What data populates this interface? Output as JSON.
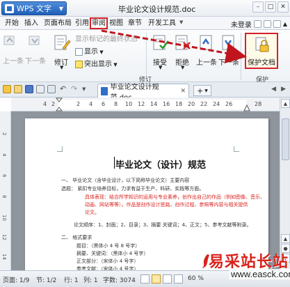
{
  "titlebar": {
    "app_button": "WPS 文字",
    "doc_title": "毕业论文设计规范.doc"
  },
  "menu": {
    "tabs": [
      "开始",
      "插入",
      "页面布局",
      "引用",
      "审阅",
      "视图",
      "章节",
      "开发工具"
    ],
    "active_tab": "审阅",
    "login": "未登录"
  },
  "ribbon": {
    "prev_label": "上一条",
    "next_label": "下一条",
    "revise_label": "修订",
    "show_markup_final": "显示标记的最终状态",
    "show_label": "显示",
    "highlight_label": "突出显示",
    "accept_label": "接受",
    "reject_label": "拒绝",
    "prev_change": "上一条",
    "next_change": "下一条",
    "group_revise": "修订",
    "protect_doc": "保护文档",
    "group_protect": "保护"
  },
  "doc_tab": {
    "title": "毕业论文设计规范.doc",
    "new_tab": "+"
  },
  "ruler": {
    "ticks": [
      "4",
      "2",
      "2",
      "4",
      "6",
      "8",
      "10",
      "12",
      "14",
      "16",
      "18",
      "20",
      "22",
      "24",
      "26",
      "28"
    ]
  },
  "vruler": {
    "ticks": [
      "2",
      "4",
      "6",
      "8",
      "10",
      "12",
      "14"
    ]
  },
  "document": {
    "heading": "毕业论文（设计）规范",
    "lines": [
      {
        "text": "一、  毕业论文（含毕业设计，以下简称毕业论文）主要内容",
        "red": false
      },
      {
        "text": "选题：  紧扣专业培养目标，力求有益于生产、科研、实践等方面。",
        "red": false
      },
      {
        "text": "具体表现：结合所学知识的运用与专业素养，创作出自己的作品（例如图像、音乐、",
        "red": true
      },
      {
        "text": "动画、网站等等）。作品是创作设计思路、创作过程、参照等内容与相关提供",
        "red": true
      },
      {
        "text": "论文。",
        "red": true
      },
      {
        "text": "论文顺序：1、封面；2、目录；3、摘要  关键词；4、正文；5、参考文献等附录。",
        "red": false
      },
      {
        "text": "二、  格式要求",
        "red": false
      },
      {
        "text": "题目：（黑体小 4 号 8 号字）",
        "red": false
      },
      {
        "text": "摘要、关键词：（黑体小 4 号字）",
        "red": false
      },
      {
        "text": "正文部分：（宋体小 4 号字）",
        "red": false
      },
      {
        "text": "参考文献：（宋体小 4 号字）",
        "red": false
      }
    ]
  },
  "status": {
    "page": "页面: 1/9",
    "section": "节: 1/2",
    "row": "行: 1",
    "col": "列: 1",
    "words": "字数: 3074",
    "zoom": "60 %"
  },
  "watermark": {
    "cn": "易采站长站",
    "en": "www.easck.com"
  },
  "colors": {
    "accent_red": "#d4202a",
    "wps_blue": "#1f5fb8",
    "doc_red_text": "#d9241f"
  }
}
